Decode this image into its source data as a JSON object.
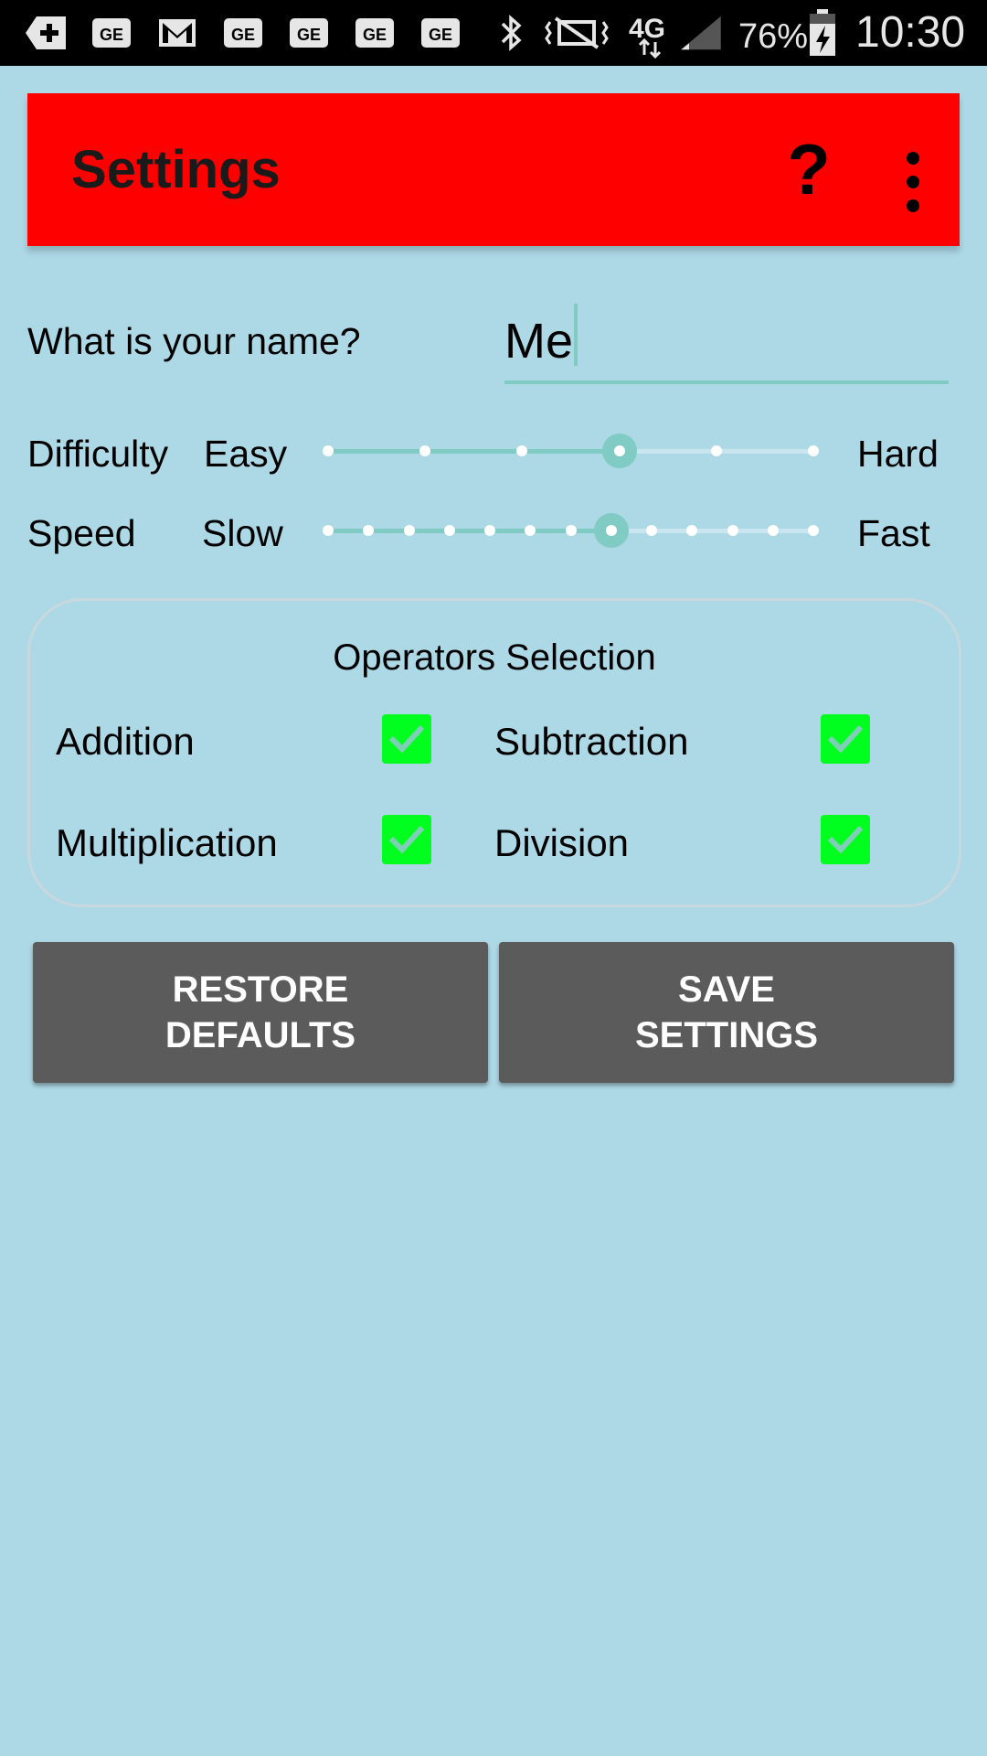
{
  "status_bar": {
    "battery": "76%",
    "time": "10:30",
    "network": "4G",
    "icons": [
      "add-icon",
      "ge-icon",
      "gmail-icon",
      "ge-icon",
      "ge-icon",
      "ge-icon",
      "ge-icon",
      "bluetooth-icon",
      "vibrate-icon",
      "signal-icon",
      "battery-charging-icon"
    ]
  },
  "appbar": {
    "title": "Settings",
    "help_label": "?",
    "colors": {
      "background": "#ff0000"
    }
  },
  "name_row": {
    "label": "What is your name?",
    "value": "Me",
    "placeholder": ""
  },
  "difficulty": {
    "label": "Difficulty",
    "min_label": "Easy",
    "max_label": "Hard",
    "steps": 6,
    "value_index": 3
  },
  "speed": {
    "label": "Speed",
    "min_label": "Slow",
    "max_label": "Fast",
    "steps": 13,
    "value_index": 7
  },
  "operators": {
    "title": "Operators Selection",
    "items": [
      {
        "label": "Addition",
        "checked": true
      },
      {
        "label": "Subtraction",
        "checked": true
      },
      {
        "label": "Multiplication",
        "checked": true
      },
      {
        "label": "Division",
        "checked": true
      }
    ]
  },
  "buttons": {
    "restore_line1": "RESTORE",
    "restore_line2": "DEFAULTS",
    "save_line1": "SAVE",
    "save_line2": "SETTINGS"
  },
  "colors": {
    "page_background": "#add8e6",
    "accent": "#80cbc4",
    "checkbox": "#00ff1e",
    "button": "#5b5b5b"
  }
}
